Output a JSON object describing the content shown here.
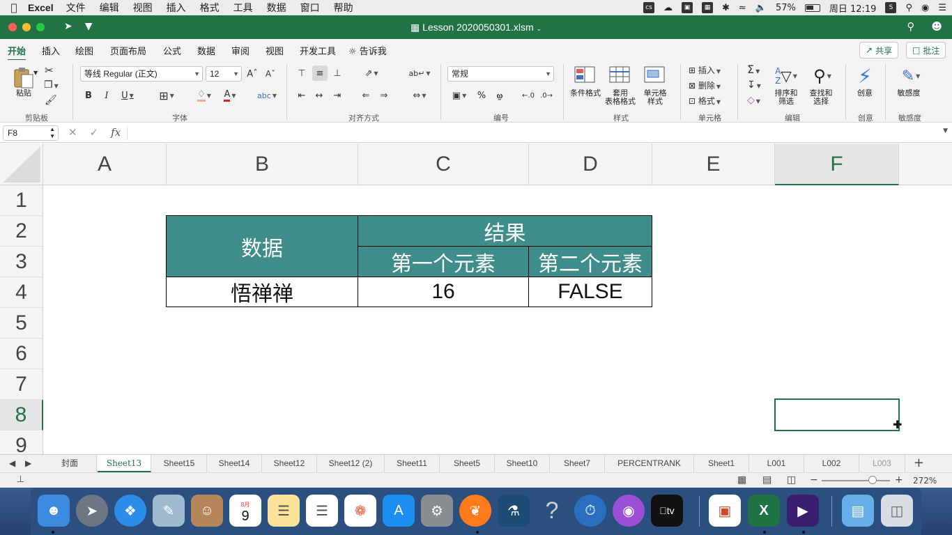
{
  "menubar": {
    "app_name": "Excel",
    "items": [
      "文件",
      "编辑",
      "视图",
      "插入",
      "格式",
      "工具",
      "数据",
      "窗口",
      "帮助"
    ],
    "battery": "57%",
    "clock": "周日 12:19"
  },
  "window": {
    "title": "Lesson 2020050301.xlsm"
  },
  "ribbon_tabs": [
    "开始",
    "插入",
    "绘图",
    "页面布局",
    "公式",
    "数据",
    "审阅",
    "视图",
    "开发工具"
  ],
  "tell_me": "告诉我",
  "share_label": "共享",
  "comments_label": "批注",
  "ribbon": {
    "paste_label": "粘贴",
    "font_name": "等线 Regular (正文)",
    "font_size": "12",
    "number_format": "常规",
    "conditional_format": "条件格式",
    "table_format_1": "套用",
    "table_format_2": "表格格式",
    "cell_style_1": "单元格",
    "cell_style_2": "样式",
    "insert": "插入",
    "delete": "删除",
    "format": "格式",
    "sort_1": "排序和",
    "sort_2": "筛选",
    "find_1": "查找和",
    "find_2": "选择",
    "ideas": "创意",
    "sensitivity": "敏感度",
    "groups": {
      "clipboard": "剪贴板",
      "font": "字体",
      "alignment": "对齐方式",
      "number": "编号",
      "styles": "样式",
      "cells": "单元格",
      "editing": "编辑",
      "ideas": "创意",
      "sensitivity": "敏感度"
    }
  },
  "formula_bar": {
    "name_box": "F8",
    "fx": "fx",
    "value": ""
  },
  "columns": [
    "A",
    "B",
    "C",
    "D",
    "E",
    "F"
  ],
  "rows": [
    "1",
    "2",
    "3",
    "4",
    "5",
    "6",
    "7",
    "8",
    "9"
  ],
  "table": {
    "data_header": "数据",
    "result_header": "结果",
    "first_element": "第一个元素",
    "second_element": "第二个元素",
    "data_value": "悟禅禅",
    "first_value": "16",
    "second_value": "FALSE"
  },
  "selected_cell": "F8",
  "sheet_tabs": [
    "封面",
    "Sheet13",
    "Sheet15",
    "Sheet14",
    "Sheet12",
    "Sheet12 (2)",
    "Sheet11",
    "Sheet5",
    "Sheet10",
    "Sheet7",
    "PERCENTRANK",
    "Sheet1",
    "L001",
    "L002",
    "L003"
  ],
  "active_sheet": "Sheet13",
  "status": {
    "zoom": "272%"
  },
  "colors": {
    "excel_green": "#217346",
    "table_header_fill": "#3f8d8a"
  },
  "dock": {
    "calendar_month": "8月",
    "calendar_day": "9"
  }
}
